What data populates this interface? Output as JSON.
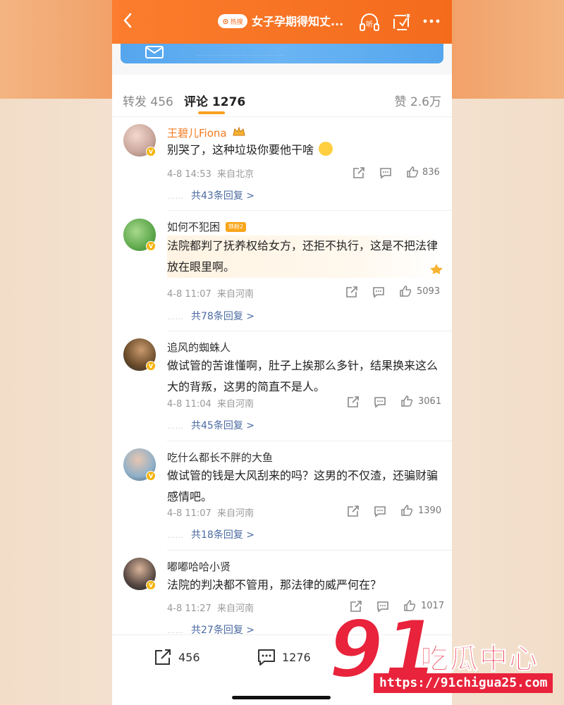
{
  "header": {
    "hot_label": "热搜",
    "title": "女子孕期得知丈...",
    "listen_label": "听"
  },
  "banner": {
    "small_text": "· · · · · · · · · · · · · · · · · · · · · · · · · · · · · · · · · · · · · · · ·"
  },
  "tabs": {
    "repost": "转发 456",
    "comment": "评论 1276",
    "like": "赞 2.6万"
  },
  "comments": [
    {
      "name": "王碧儿Fiona",
      "text": "别哭了，这种垃圾你要他干啥",
      "time": "4-8 14:53",
      "location": "来自北京",
      "likes": "836",
      "replies": "共43条回复 >"
    },
    {
      "name": "如何不犯困",
      "badge": "铁粉2",
      "text": "法院都判了抚养权给女方，还拒不执行，这是不把法律放在眼里啊。",
      "time": "4-8 11:07",
      "location": "来自河南",
      "likes": "5093",
      "replies": "共78条回复 >"
    },
    {
      "name": "追风的蜘蛛人",
      "text": "做试管的苦谁懂啊，肚子上挨那么多针，结果换来这么大的背叛，这男的简直不是人。",
      "time": "4-8 11:04",
      "location": "来自河南",
      "likes": "3061",
      "replies": "共45条回复 >"
    },
    {
      "name": "吃什么都长不胖的大鱼",
      "text": "做试管的钱是大风刮来的吗？这男的不仅渣，还骗财骗感情吧。",
      "time": "4-8 11:07",
      "location": "来自河南",
      "likes": "1390",
      "replies": "共18条回复 >"
    },
    {
      "name": "嘟嘟哈哈小贤",
      "text": "法院的判决都不管用，那法律的威严何在？",
      "time": "4-8 11:27",
      "location": "来自河南",
      "likes": "1017",
      "replies": "共27条回复 >"
    }
  ],
  "bottombar": {
    "repost": "456",
    "comment": "1276"
  },
  "watermark": {
    "number": "91",
    "text": "吃瓜中心",
    "url": "https://91chigua25.com"
  },
  "colors": {
    "accent": "#f46b1c",
    "vip_name": "#f47b20",
    "link": "#4a6aa0",
    "watermark": "#e8233b"
  }
}
